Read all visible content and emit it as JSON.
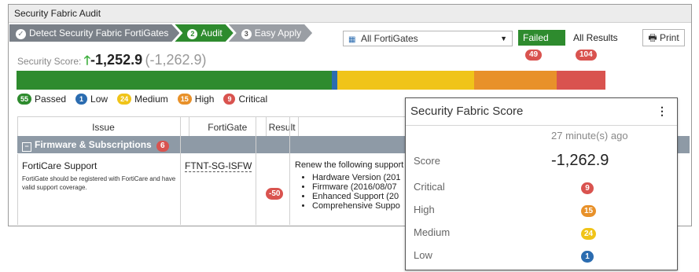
{
  "window": {
    "title": "Security Fabric Audit"
  },
  "steps": [
    {
      "num": "",
      "label": "Detect Security Fabric FortiGates"
    },
    {
      "num": "2",
      "label": "Audit"
    },
    {
      "num": "3",
      "label": "Easy Apply"
    }
  ],
  "filter": {
    "selected": "All FortiGates"
  },
  "buttons": {
    "failed_label": "Failed",
    "failed_count": "49",
    "all_label": "All Results",
    "all_count": "104",
    "print_label": "Print"
  },
  "score": {
    "label": "Security Score:",
    "value": "-1,252.9",
    "previous": "(-1,262.9)"
  },
  "bar_segments": [
    {
      "name": "Passed",
      "fraction": 0.536,
      "color": "#2e8b2e"
    },
    {
      "name": "Low",
      "fraction": 0.009,
      "color": "#2b6cb0"
    },
    {
      "name": "Medium",
      "fraction": 0.232,
      "color": "#f0c419"
    },
    {
      "name": "High",
      "fraction": 0.14,
      "color": "#e8912a"
    },
    {
      "name": "Critical",
      "fraction": 0.083,
      "color": "#d9534f"
    }
  ],
  "legend": [
    {
      "count": "55",
      "label": "Passed",
      "color": "#2e8b2e"
    },
    {
      "count": "1",
      "label": "Low",
      "color": "#2b6cb0"
    },
    {
      "count": "24",
      "label": "Medium",
      "color": "#f0c419"
    },
    {
      "count": "15",
      "label": "High",
      "color": "#e8912a"
    },
    {
      "count": "9",
      "label": "Critical",
      "color": "#d9534f"
    }
  ],
  "table": {
    "headers": {
      "issue": "Issue",
      "fortigate": "FortiGate",
      "result": "Result"
    },
    "group": {
      "label": "Firmware & Subscriptions",
      "count": "6"
    },
    "row": {
      "title": "FortiCare Support",
      "description": "FortiGate should be registered with FortiCare and have valid support coverage.",
      "fortigate": "FTNT-SG-ISFW",
      "result": "-50",
      "recommendation_title": "Renew the following support",
      "recommendation_items": [
        "Hardware Version (201",
        "Firmware (2016/08/07",
        "Enhanced Support (20",
        "Comprehensive Suppo"
      ]
    }
  },
  "popup": {
    "title": "Security Fabric Score",
    "time_ago": "27 minute(s) ago",
    "score_label": "Score",
    "score_value": "-1,262.9",
    "critical_label": "Critical",
    "critical_value": "9",
    "high_label": "High",
    "high_value": "15",
    "medium_label": "Medium",
    "medium_value": "24",
    "low_label": "Low",
    "low_value": "1"
  },
  "colors": {
    "green": "#2e8b2e",
    "blue": "#2b6cb0",
    "yellow": "#f0c419",
    "orange": "#e8912a",
    "red": "#d9534f"
  }
}
